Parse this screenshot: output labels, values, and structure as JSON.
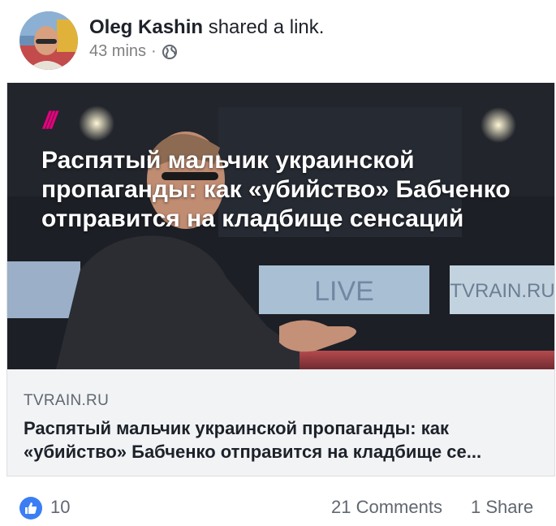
{
  "post": {
    "author": "Oleg Kashin",
    "action": "shared a link.",
    "time": "43 mins",
    "separator": "·",
    "privacy_icon": "globe-icon"
  },
  "link_card": {
    "image_logo": "///",
    "image_headline": "Распятый мальчик украинской пропаганды: как «убийство» Бабченко отправится на кладбище сенсаций",
    "image_background_text_1": "LIVE",
    "image_background_text_2": "TVRAIN.RU",
    "domain": "TVRAIN.RU",
    "title": "Распятый мальчик украинской пропаганды: как «убийство» Бабченко отправится на кладбище се..."
  },
  "footer": {
    "reaction_icon": "like-icon",
    "likes": "10",
    "comments": "21 Comments",
    "shares": "1 Share"
  },
  "colors": {
    "like_blue": "#3b7ef4",
    "brand_pink": "#e6007e"
  }
}
